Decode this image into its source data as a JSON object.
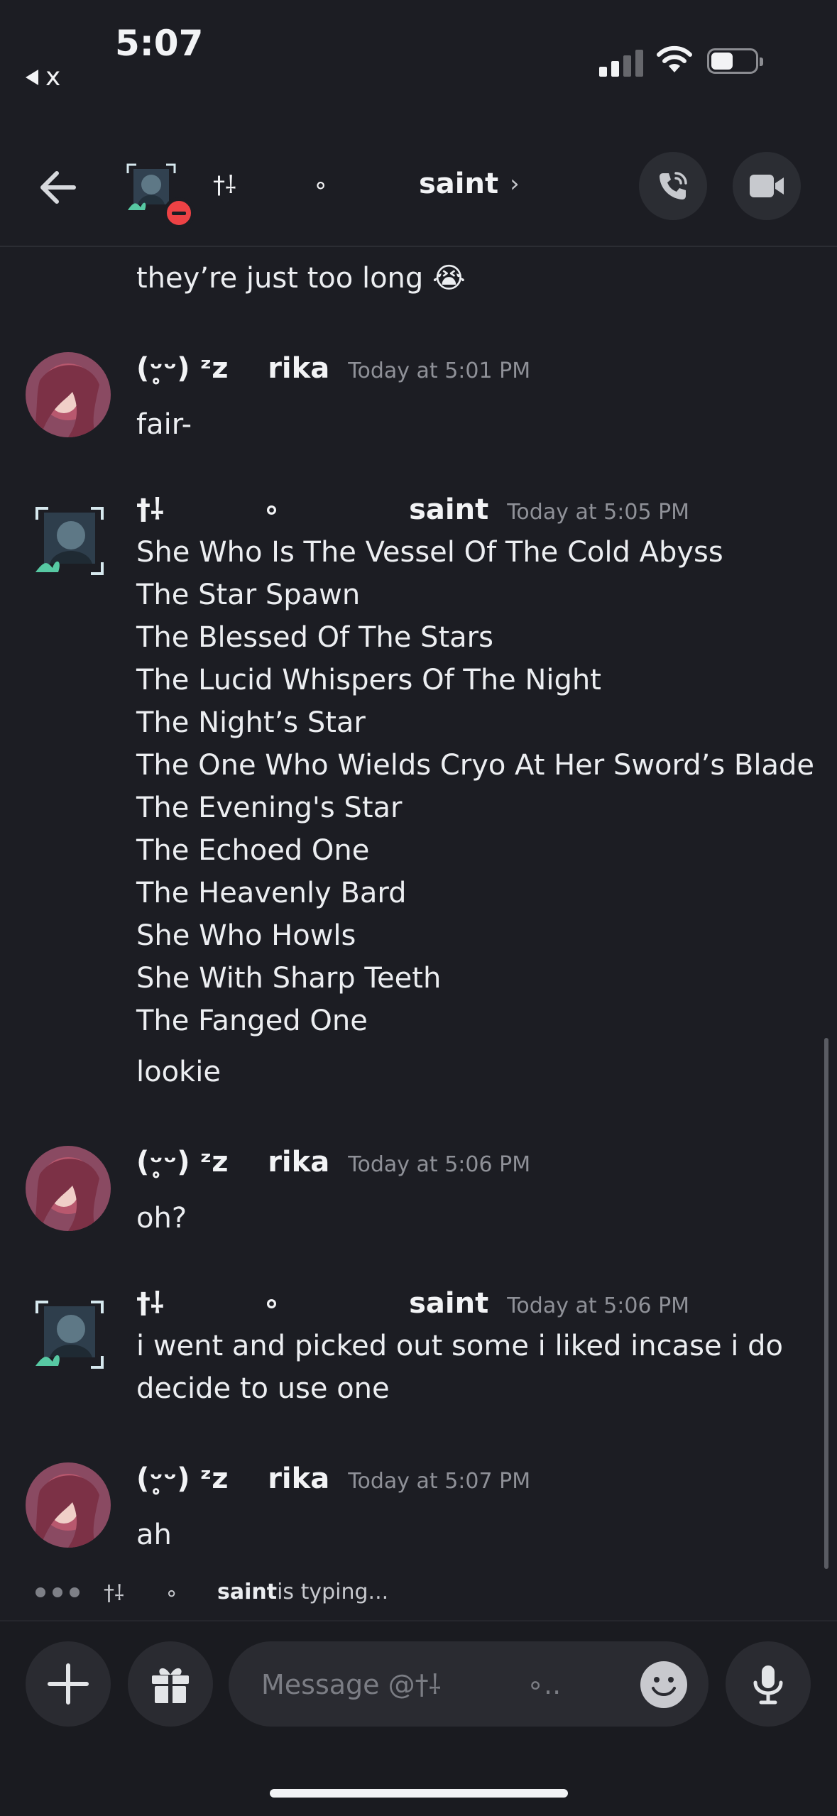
{
  "status_bar": {
    "time": "5:07",
    "back_app": "x"
  },
  "header": {
    "username_decoration": "†⸸          ∘",
    "username": "saint",
    "chevron": "›"
  },
  "messages": [
    {
      "id": "m0",
      "text": "they’re just too long 😭"
    },
    {
      "id": "m1",
      "author_prefix": "(ᵕ̥ᵕ) ᶻz    ",
      "author": "rika",
      "time": "Today at 5:01 PM",
      "lines": [
        "fair-"
      ]
    },
    {
      "id": "m2",
      "author_prefix": "†⸸          ∘             ",
      "author": "saint",
      "time": "Today at 5:05 PM",
      "lines": [
        "She Who Is The Vessel Of The Cold Abyss",
        "The Star Spawn",
        "The Blessed Of The Stars",
        "The Lucid Whispers Of The Night",
        "The Night’s Star",
        "The One Who Wields Cryo At Her Sword’s Blade",
        "The Evening's Star",
        "The Echoed One",
        "The Heavenly Bard",
        "She Who Howls",
        "She With Sharp Teeth",
        "The Fanged One"
      ],
      "followup": "lookie"
    },
    {
      "id": "m3",
      "author_prefix": "(ᵕ̥ᵕ) ᶻz    ",
      "author": "rika",
      "time": "Today at 5:06 PM",
      "lines": [
        "oh?"
      ]
    },
    {
      "id": "m4",
      "author_prefix": "†⸸          ∘             ",
      "author": "saint",
      "time": "Today at 5:06 PM",
      "lines": [
        "i went and picked out some i liked incase i do",
        "decide to use one"
      ]
    },
    {
      "id": "m5",
      "author_prefix": "(ᵕ̥ᵕ) ᶻz    ",
      "author": "rika",
      "time": "Today at 5:07 PM",
      "lines": [
        "ah"
      ]
    }
  ],
  "typing": {
    "decoration": "†⸸      ∘",
    "name": "saint",
    "suffix": " is typing..."
  },
  "input": {
    "placeholder": "Message @†⸸          ∘..."
  },
  "icons": {
    "back": "arrow-left-icon",
    "call": "phone-icon",
    "video": "video-camera-icon",
    "add": "plus-icon",
    "gift": "gift-icon",
    "emoji": "emoji-icon",
    "mic": "microphone-icon"
  },
  "colors": {
    "background": "#1c1d23",
    "dnd": "#ed4245",
    "timestamp": "#8f9198"
  }
}
